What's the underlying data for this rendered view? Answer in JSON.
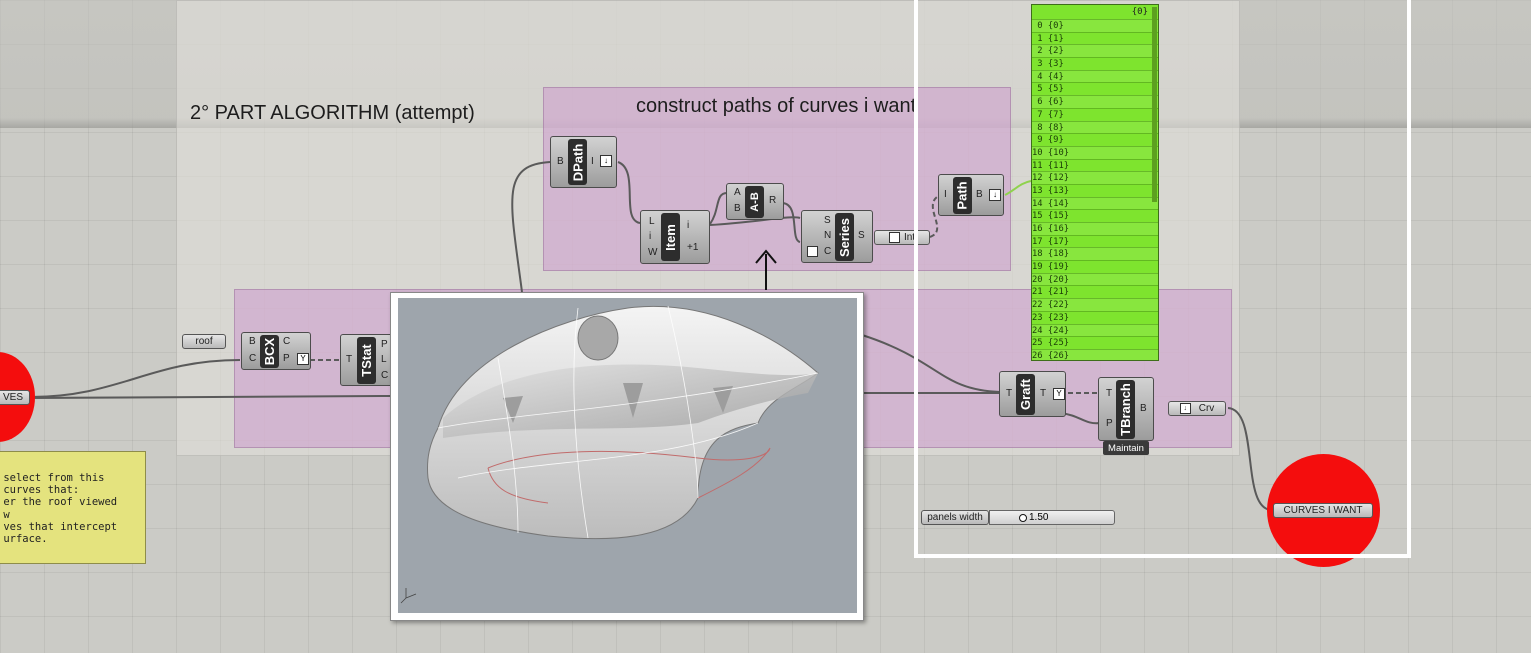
{
  "groups": {
    "main_title": "2° PART ALGORITHM (attempt)",
    "paths_title": "construct paths of curves i want"
  },
  "components": {
    "dpath": {
      "label": "DPath",
      "in": "B",
      "out": "I"
    },
    "item": {
      "label": "Item",
      "in": [
        "L",
        "i",
        "W"
      ],
      "out": [
        "i",
        "+1"
      ]
    },
    "ab": {
      "label": "A-B",
      "in": [
        "A",
        "B"
      ],
      "out": "R"
    },
    "series": {
      "label": "Series",
      "in": [
        "S",
        "N",
        "C"
      ],
      "out": "S"
    },
    "path": {
      "label": "Path",
      "in": "I",
      "out": "B"
    },
    "bcx": {
      "label": "BCX",
      "in": [
        "B",
        "C"
      ],
      "out": [
        "C",
        "P"
      ]
    },
    "tstat": {
      "label": "TStat",
      "in": "T",
      "out": [
        "P",
        "L",
        "C"
      ]
    },
    "graft": {
      "label": "Graft",
      "in": "T",
      "out": "T"
    },
    "tbranch": {
      "label": "TBranch",
      "in": [
        "T",
        "P"
      ],
      "out": "B",
      "maintain": "Maintain"
    }
  },
  "params": {
    "roof": "roof",
    "int": "Int",
    "crv": "Crv",
    "curves_left": "VES",
    "curves_i_want": "CURVES I WANT"
  },
  "slider": {
    "label": "panels width",
    "value": "1.50"
  },
  "note_text": " select from this\n curves that:\n er the roof viewed\n w\n ves that intercept\n urface.",
  "panel": {
    "header": "{0}",
    "rows": [
      "0 {0}",
      "1 {1}",
      "2 {2}",
      "3 {3}",
      "4 {4}",
      "5 {5}",
      "6 {6}",
      "7 {7}",
      "8 {8}",
      "9 {9}",
      "10 {10}",
      "11 {11}",
      "12 {12}",
      "13 {13}",
      "14 {14}",
      "15 {15}",
      "16 {16}",
      "17 {17}",
      "18 {18}",
      "19 {19}",
      "20 {20}",
      "21 {21}",
      "22 {22}",
      "23 {23}",
      "24 {24}",
      "25 {25}",
      "26 {26}"
    ]
  },
  "colors": {
    "panel": "#7ee42e",
    "group": "#cd9bcd",
    "note": "#e4e37e",
    "red": "#f40d0d"
  }
}
